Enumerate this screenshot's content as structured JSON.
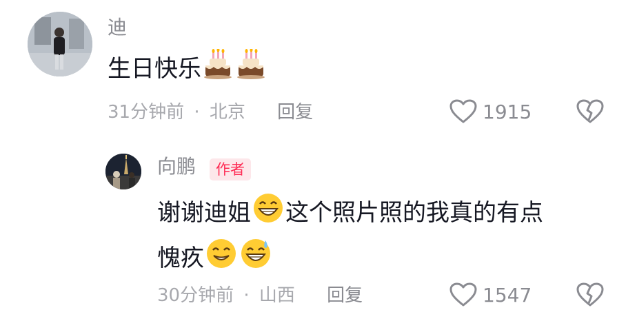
{
  "comments": [
    {
      "author": "迪",
      "text": "生日快乐",
      "text_emojis": [
        "birthday-cake",
        "birthday-cake"
      ],
      "time": "31分钟前",
      "separator": "·",
      "location": "北京",
      "reply_label": "回复",
      "likes": "1915"
    },
    {
      "author": "向鹏",
      "badge": "作者",
      "text_line1": "谢谢迪姐",
      "text_line1_rest": "这个照片照的我真的有点",
      "text_line2": "愧疚",
      "time": "30分钟前",
      "separator": "·",
      "location": "山西",
      "reply_label": "回复",
      "likes": "1547"
    }
  ],
  "colors": {
    "primary_text": "#161823",
    "secondary_text": "#8a8b91",
    "meta_text": "#a7a8ad",
    "badge_bg": "#fde7ea",
    "badge_text": "#fe2c55"
  }
}
